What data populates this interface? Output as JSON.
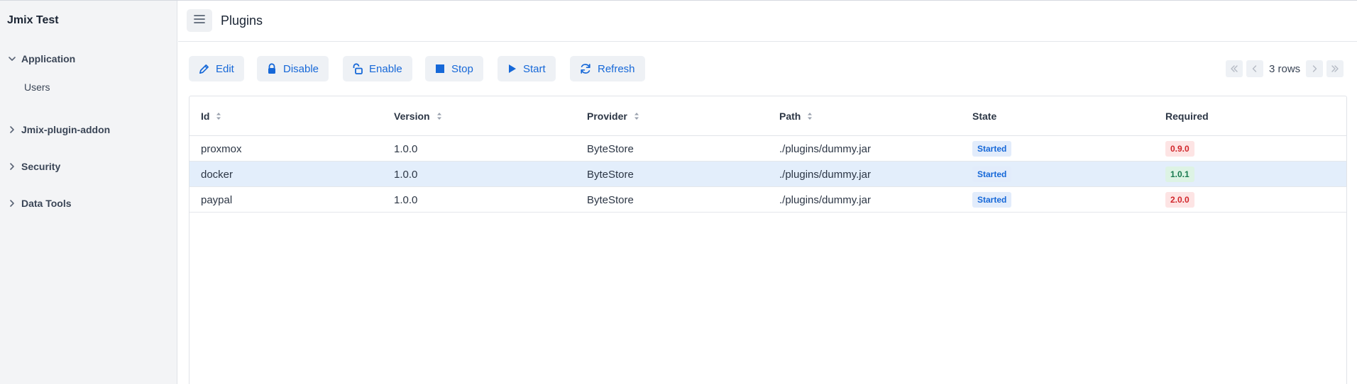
{
  "app": {
    "title": "Jmix Test"
  },
  "sidebar": {
    "groups": [
      {
        "label": "Application",
        "expanded": true,
        "items": [
          {
            "label": "Users"
          }
        ]
      },
      {
        "label": "Jmix-plugin-addon",
        "expanded": false,
        "items": []
      },
      {
        "label": "Security",
        "expanded": false,
        "items": []
      },
      {
        "label": "Data Tools",
        "expanded": false,
        "items": []
      }
    ]
  },
  "header": {
    "title": "Plugins",
    "menu_icon": "hamburger-icon"
  },
  "toolbar": {
    "buttons": [
      {
        "label": "Edit",
        "icon": "pencil-icon"
      },
      {
        "label": "Disable",
        "icon": "lock-icon"
      },
      {
        "label": "Enable",
        "icon": "unlock-icon"
      },
      {
        "label": "Stop",
        "icon": "stop-icon"
      },
      {
        "label": "Start",
        "icon": "play-icon"
      },
      {
        "label": "Refresh",
        "icon": "refresh-icon"
      }
    ]
  },
  "pagination": {
    "rows_label": "3 rows"
  },
  "table": {
    "columns": [
      "Id",
      "Version",
      "Provider",
      "Path",
      "State",
      "Required"
    ],
    "sortable": [
      true,
      true,
      true,
      true,
      false,
      false
    ],
    "rows": [
      {
        "id": "proxmox",
        "version": "1.0.0",
        "provider": "ByteStore",
        "path": "./plugins/dummy.jar",
        "state": "Started",
        "required": "0.9.0",
        "required_status": "error",
        "selected": false
      },
      {
        "id": "docker",
        "version": "1.0.0",
        "provider": "ByteStore",
        "path": "./plugins/dummy.jar",
        "state": "Started",
        "required": "1.0.1",
        "required_status": "success",
        "selected": true
      },
      {
        "id": "paypal",
        "version": "1.0.0",
        "provider": "ByteStore",
        "path": "./plugins/dummy.jar",
        "state": "Started",
        "required": "2.0.0",
        "required_status": "error",
        "selected": false
      }
    ]
  },
  "colors": {
    "accent": "#1668d8",
    "sidebar_bg": "#f3f4f6",
    "selected_row": "#e3eefb",
    "badge_error_bg": "#fde4e4",
    "badge_error_text": "#d1262b",
    "badge_success_bg": "#ddf3e4",
    "badge_success_text": "#18794e"
  }
}
